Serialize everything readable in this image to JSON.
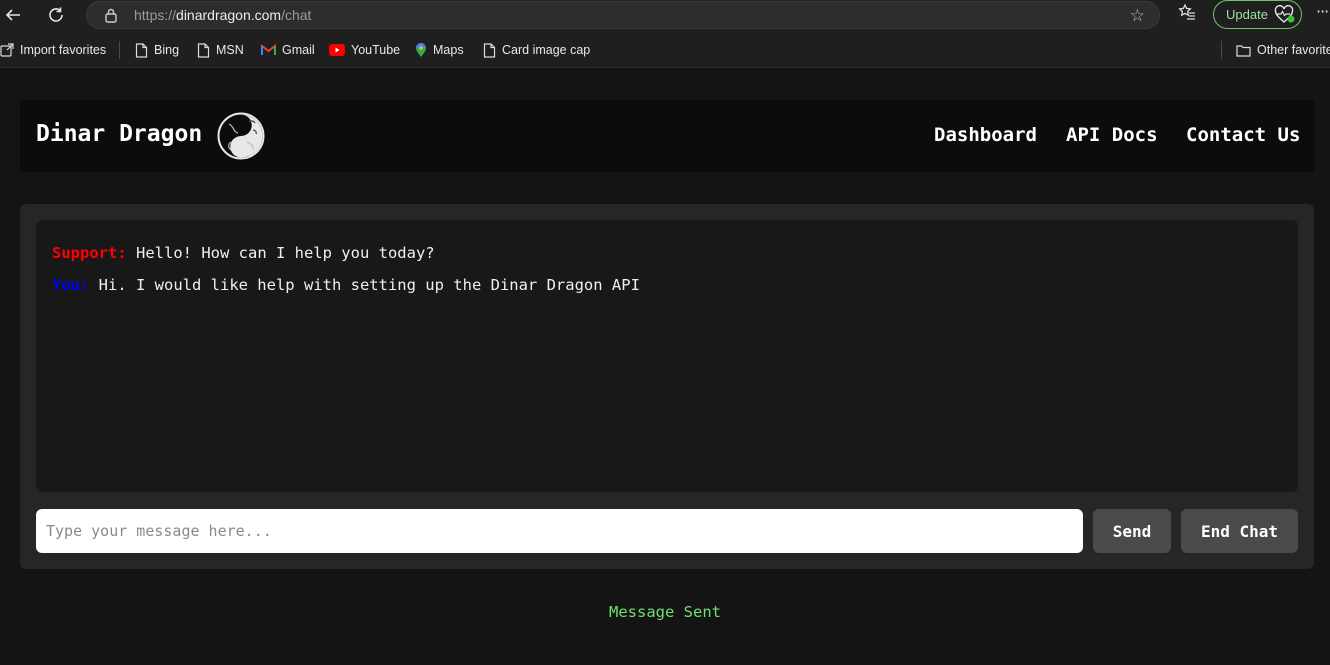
{
  "browser": {
    "url_scheme": "https://",
    "url_host": "dinardragon.com",
    "url_path": "/chat",
    "update_label": "Update",
    "bookmarks": [
      {
        "label": "Import favorites",
        "icon": "import-icon"
      },
      {
        "label": "Bing",
        "icon": "page-icon"
      },
      {
        "label": "MSN",
        "icon": "page-icon"
      },
      {
        "label": "Gmail",
        "icon": "gmail-icon"
      },
      {
        "label": "YouTube",
        "icon": "youtube-icon"
      },
      {
        "label": "Maps",
        "icon": "maps-pin-icon"
      },
      {
        "label": "Card image cap",
        "icon": "page-icon"
      }
    ],
    "other_favorites_label": "Other favorites"
  },
  "site": {
    "brand": "Dinar Dragon",
    "logo_icon": "dragon-yin-yang-logo-icon",
    "nav": [
      "Dashboard",
      "API Docs",
      "Contact Us"
    ]
  },
  "chat": {
    "messages": [
      {
        "sender": "Support:",
        "text": "Hello! How can I help you today?"
      },
      {
        "sender": "You:",
        "text": "Hi. I would like help with setting up the Dinar Dragon API"
      }
    ],
    "input_value": "",
    "input_placeholder": "Type your message here...",
    "send_label": "Send",
    "end_label": "End Chat",
    "status": "Message Sent"
  },
  "colors": {
    "support_sender": "#ff0000",
    "you_sender": "#0000ff",
    "status": "#6fe06f",
    "page_bg": "#141414",
    "card_bg": "#262626",
    "update_accent": "#6cc36c"
  }
}
